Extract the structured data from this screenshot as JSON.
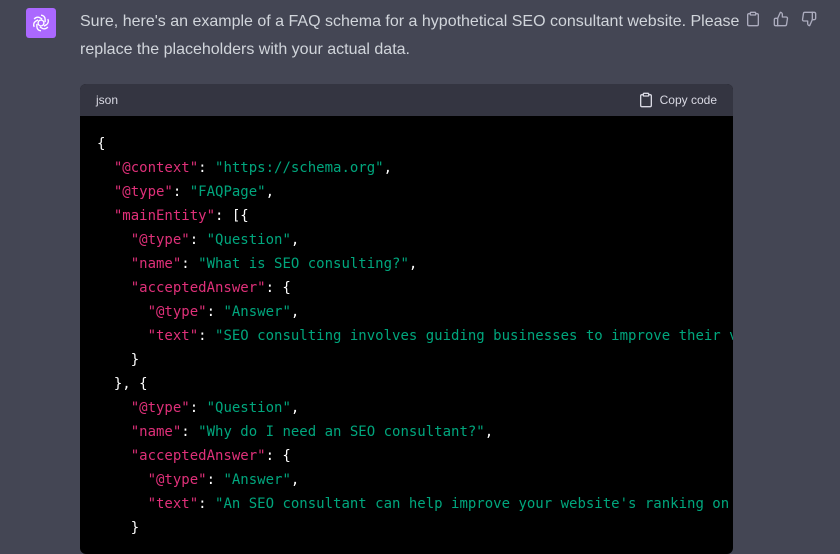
{
  "message": {
    "text": "Sure, here's an example of a FAQ schema for a hypothetical SEO consultant website. Please replace the placeholders with your actual data."
  },
  "actions": {
    "icons": [
      "clipboard-icon",
      "thumbs-up-icon",
      "thumbs-down-icon"
    ]
  },
  "code_block": {
    "language": "json",
    "copy_label": "Copy code",
    "lines": [
      [
        {
          "t": "p",
          "v": "{"
        }
      ],
      [
        {
          "t": "p",
          "v": "  "
        },
        {
          "t": "k",
          "v": "\"@context\""
        },
        {
          "t": "p",
          "v": ": "
        },
        {
          "t": "s",
          "v": "\"https://schema.org\""
        },
        {
          "t": "p",
          "v": ","
        }
      ],
      [
        {
          "t": "p",
          "v": "  "
        },
        {
          "t": "k",
          "v": "\"@type\""
        },
        {
          "t": "p",
          "v": ": "
        },
        {
          "t": "s",
          "v": "\"FAQPage\""
        },
        {
          "t": "p",
          "v": ","
        }
      ],
      [
        {
          "t": "p",
          "v": "  "
        },
        {
          "t": "k",
          "v": "\"mainEntity\""
        },
        {
          "t": "p",
          "v": ": [{"
        }
      ],
      [
        {
          "t": "p",
          "v": "    "
        },
        {
          "t": "k",
          "v": "\"@type\""
        },
        {
          "t": "p",
          "v": ": "
        },
        {
          "t": "s",
          "v": "\"Question\""
        },
        {
          "t": "p",
          "v": ","
        }
      ],
      [
        {
          "t": "p",
          "v": "    "
        },
        {
          "t": "k",
          "v": "\"name\""
        },
        {
          "t": "p",
          "v": ": "
        },
        {
          "t": "s",
          "v": "\"What is SEO consulting?\""
        },
        {
          "t": "p",
          "v": ","
        }
      ],
      [
        {
          "t": "p",
          "v": "    "
        },
        {
          "t": "k",
          "v": "\"acceptedAnswer\""
        },
        {
          "t": "p",
          "v": ": {"
        }
      ],
      [
        {
          "t": "p",
          "v": "      "
        },
        {
          "t": "k",
          "v": "\"@type\""
        },
        {
          "t": "p",
          "v": ": "
        },
        {
          "t": "s",
          "v": "\"Answer\""
        },
        {
          "t": "p",
          "v": ","
        }
      ],
      [
        {
          "t": "p",
          "v": "      "
        },
        {
          "t": "k",
          "v": "\"text\""
        },
        {
          "t": "p",
          "v": ": "
        },
        {
          "t": "s",
          "v": "\"SEO consulting involves guiding businesses to improve their v"
        }
      ],
      [
        {
          "t": "p",
          "v": "    }"
        }
      ],
      [
        {
          "t": "p",
          "v": "  }, {"
        }
      ],
      [
        {
          "t": "p",
          "v": "    "
        },
        {
          "t": "k",
          "v": "\"@type\""
        },
        {
          "t": "p",
          "v": ": "
        },
        {
          "t": "s",
          "v": "\"Question\""
        },
        {
          "t": "p",
          "v": ","
        }
      ],
      [
        {
          "t": "p",
          "v": "    "
        },
        {
          "t": "k",
          "v": "\"name\""
        },
        {
          "t": "p",
          "v": ": "
        },
        {
          "t": "s",
          "v": "\"Why do I need an SEO consultant?\""
        },
        {
          "t": "p",
          "v": ","
        }
      ],
      [
        {
          "t": "p",
          "v": "    "
        },
        {
          "t": "k",
          "v": "\"acceptedAnswer\""
        },
        {
          "t": "p",
          "v": ": {"
        }
      ],
      [
        {
          "t": "p",
          "v": "      "
        },
        {
          "t": "k",
          "v": "\"@type\""
        },
        {
          "t": "p",
          "v": ": "
        },
        {
          "t": "s",
          "v": "\"Answer\""
        },
        {
          "t": "p",
          "v": ","
        }
      ],
      [
        {
          "t": "p",
          "v": "      "
        },
        {
          "t": "k",
          "v": "\"text\""
        },
        {
          "t": "p",
          "v": ": "
        },
        {
          "t": "s",
          "v": "\"An SEO consultant can help improve your website's ranking on "
        }
      ],
      [
        {
          "t": "p",
          "v": "    }"
        }
      ]
    ]
  },
  "colors": {
    "background": "#444654",
    "code_background": "#000000",
    "code_header": "#343541",
    "key": "#df3079",
    "string": "#00a67d",
    "avatar": "#ab68ff"
  }
}
